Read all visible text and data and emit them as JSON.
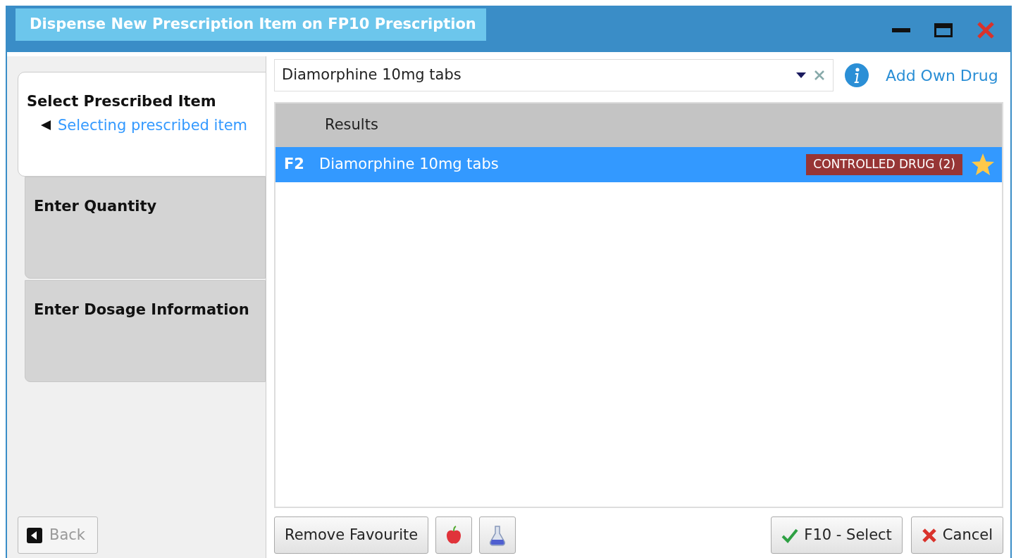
{
  "window": {
    "title": "Dispense New Prescription Item on FP10 Prescription"
  },
  "steps": [
    {
      "label": "Select Prescribed Item",
      "selected": true,
      "substep": "Selecting prescribed item"
    },
    {
      "label": "Enter Quantity",
      "selected": false
    },
    {
      "label": "Enter Dosage Information",
      "selected": false
    }
  ],
  "back_button": {
    "label": "Back",
    "disabled": true
  },
  "search": {
    "value": "Diamorphine 10mg tabs"
  },
  "add_own_drug_link": "Add Own Drug",
  "results": {
    "header": "Results",
    "rows": [
      {
        "key": "F2",
        "name": "Diamorphine 10mg tabs",
        "tag": "CONTROLLED DRUG (2)",
        "favourite": true,
        "selected": true
      }
    ]
  },
  "buttons_left": [
    {
      "kind": "text",
      "label": "Remove Favourite"
    },
    {
      "kind": "apple"
    },
    {
      "kind": "flask"
    }
  ],
  "buttons_right": [
    {
      "kind": "ok",
      "label": "F10 - Select"
    },
    {
      "kind": "cancel",
      "label": "Cancel"
    }
  ]
}
